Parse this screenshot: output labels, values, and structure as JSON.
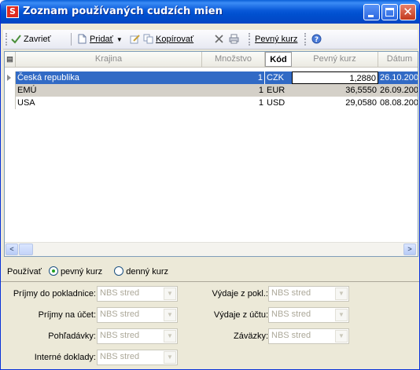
{
  "window": {
    "title": "Zoznam používaných cudzích mien",
    "app_icon_letter": "S",
    "close_glyph": "✕"
  },
  "toolbar": {
    "close_label": "Zavrieť",
    "add_label": "Pridať",
    "copy_label": "Kopírovať",
    "fixed_rate_label": "Pevný kurz"
  },
  "grid": {
    "columns": [
      "Krajina",
      "Množstvo",
      "Kód",
      "Pevný kurz",
      "Dátum"
    ],
    "rows": [
      {
        "country": "Česká republika",
        "quantity": "1",
        "code": "CZK",
        "rate": "1,2880",
        "date": "26.10.200"
      },
      {
        "country": "EMÚ",
        "quantity": "1",
        "code": "EUR",
        "rate": "36,5550",
        "date": "26.09.200"
      },
      {
        "country": "USA",
        "quantity": "1",
        "code": "USD",
        "rate": "29,0580",
        "date": "08.08.200"
      }
    ],
    "scroll_left": "<",
    "scroll_right": ">"
  },
  "use": {
    "label": "Používať",
    "option_fixed": "pevný kurz",
    "option_daily": "denný kurz",
    "selected": "pevný kurz"
  },
  "fields": {
    "cash_in_label": "Príjmy do pokladnice:",
    "cash_in_value": "NBS stred",
    "account_in_label": "Príjmy na účet:",
    "account_in_value": "NBS stred",
    "receivables_label": "Pohľadávky:",
    "receivables_value": "NBS stred",
    "internal_label": "Interné doklady:",
    "internal_value": "NBS stred",
    "cash_out_label": "Výdaje z pokl.:",
    "cash_out_value": "NBS stred",
    "account_out_label": "Výdaje z účtu:",
    "account_out_value": "NBS stred",
    "liabilities_label": "Záväzky:",
    "liabilities_value": "NBS stred"
  },
  "colors": {
    "titlebar": "#0050d0",
    "selection": "#316ac5",
    "close_button": "#c2391d"
  }
}
